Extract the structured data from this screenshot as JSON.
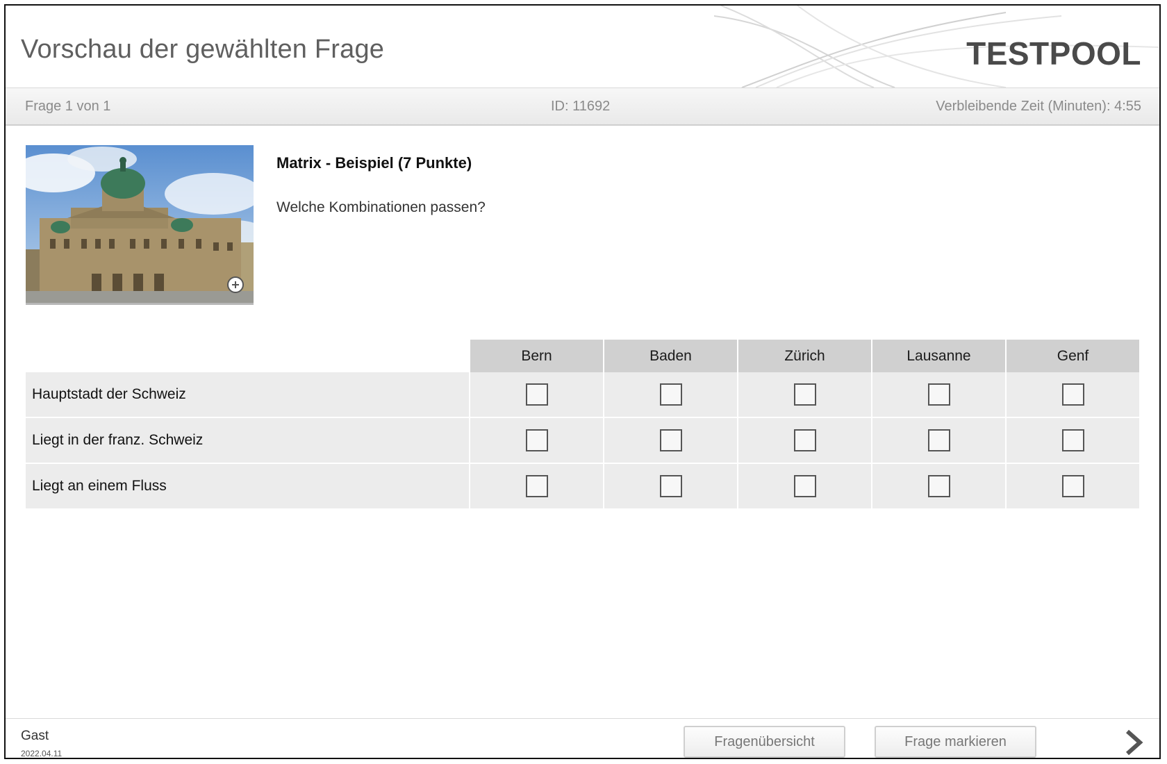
{
  "header": {
    "title": "Vorschau der gewählten Frage",
    "brand": "TESTPOOL"
  },
  "infobar": {
    "progress": "Frage 1 von 1",
    "id": "ID: 11692",
    "remaining": "Verbleibende Zeit (Minuten):  4:55"
  },
  "question": {
    "image_icon": "zoom-plus-icon",
    "title": "Matrix - Beispiel (7 Punkte)",
    "text": "Welche Kombinationen passen?"
  },
  "matrix": {
    "columns": [
      "Bern",
      "Baden",
      "Zürich",
      "Lausanne",
      "Genf"
    ],
    "rows": [
      {
        "label": "Hauptstadt der Schweiz",
        "checked": [
          false,
          false,
          false,
          false,
          false
        ]
      },
      {
        "label": "Liegt in der franz. Schweiz",
        "checked": [
          false,
          false,
          false,
          false,
          false
        ]
      },
      {
        "label": "Liegt an einem Fluss",
        "checked": [
          false,
          false,
          false,
          false,
          false
        ]
      }
    ]
  },
  "footer": {
    "user": "Gast",
    "date": "2022.04.11",
    "overview_button": "Fragenübersicht",
    "mark_button": "Frage markieren",
    "next_icon": "chevron-right-icon"
  },
  "colors": {
    "header_bg": "#ffffff",
    "infobar_bg": "#eeeeee",
    "matrix_header_bg": "#d0d0d0",
    "matrix_row_bg": "#ececec",
    "title_text": "#5f5f5f"
  }
}
